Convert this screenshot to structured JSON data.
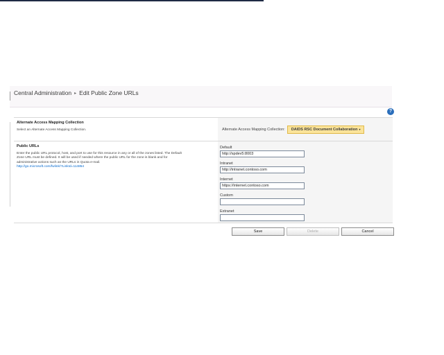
{
  "breadcrumb": {
    "root": "Central Administration",
    "separator": "▸",
    "current": "Edit Public Zone URLs"
  },
  "help": {
    "icon": "help-icon",
    "glyph": "?"
  },
  "aam_section": {
    "title": "Alternate Access Mapping Collection",
    "description": "Select an Alternate Access Mapping Collection.",
    "label": "Alternate Access Mapping Collection:",
    "selected": "DAIDS RSC Document Collaboration",
    "caret": "▾"
  },
  "public_urls": {
    "title": "Public URLs",
    "description": "Enter the public URL protocol, host, and port to use for this resource in any or all of the zones listed.  The Default Zone URL must be defined.  It will be used if needed where the public URL for the zone is blank and for administrative actions such as the URLs in Quota e-mail.",
    "link": "http://go.microsoft.com/fwlink/?LinkId=114854",
    "zones": [
      {
        "label": "Default",
        "value": "http://spdev5:8003"
      },
      {
        "label": "Intranet",
        "value": "http://intranet.contoso.com"
      },
      {
        "label": "Internet",
        "value": "https://internet.contoso.com"
      },
      {
        "label": "Custom",
        "value": ""
      },
      {
        "label": "Extranet",
        "value": ""
      }
    ]
  },
  "buttons": {
    "save": "Save",
    "delete": "Delete",
    "cancel": "Cancel"
  },
  "colors": {
    "dropdown_bg": "#fbe49a",
    "link": "#0066cc",
    "help": "#2a6ebb"
  }
}
